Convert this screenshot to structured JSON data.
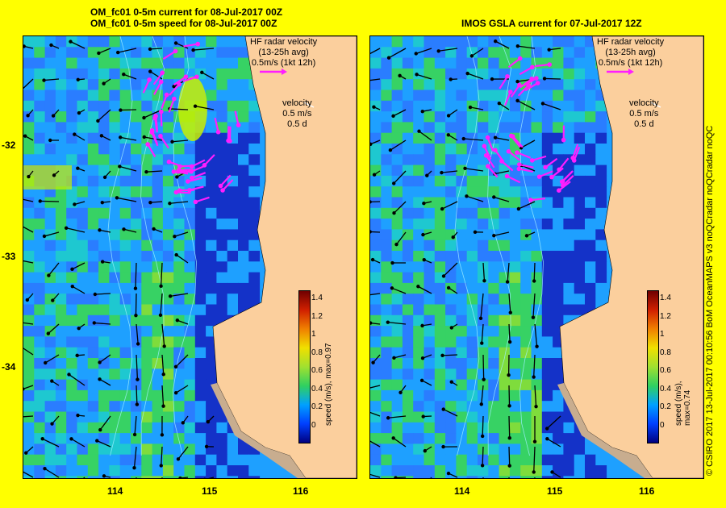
{
  "left_panel": {
    "title_line1": "OM_fc01 0-5m current for 08-Jul-2017 00Z",
    "title_line2": "OM_fc01 0-5m speed for 08-Jul-2017 00Z",
    "radar_legend": [
      "HF radar velocity",
      "(13-25h avg)",
      "0.5m/s (1kt 12h)"
    ],
    "velocity_legend": [
      "velocity",
      "0.5 m/s",
      "0.5 d"
    ],
    "colorbar_label": "speed (m/s), max=0.97"
  },
  "right_panel": {
    "title_line1": "IMOS GSLA current for 07-Jul-2017 12Z",
    "radar_legend": [
      "HF radar velocity",
      "(13-25h avg)",
      "0.5m/s (1kt 12h)"
    ],
    "velocity_legend": [
      "velocity",
      "0.5 m/s",
      "0.5 d"
    ],
    "colorbar_label": "speed (m/s), max=0.74"
  },
  "colorbar_ticks": [
    "1.4",
    "1.2",
    "1",
    "0.8",
    "0.6",
    "0.4",
    "0.2",
    "0"
  ],
  "x_ticks": [
    "114",
    "115",
    "116"
  ],
  "y_ticks": [
    "-32",
    "-33",
    "-34"
  ],
  "credit": "© CSIRO 2017   13-Jul-2017 00:10:56 BoM OceanMAPS v3 noQCradar noQCradar noQC",
  "colors": {
    "land": "#fbcf9d",
    "shelf_land": "#c8ad8f",
    "ocean_low": "#1432c8",
    "ocean_mid": "#1ea0ff",
    "ocean_high": "#37d264",
    "current_core": "#c8f000",
    "radar_arrow": "#ff1eff",
    "background": "#ffff00"
  }
}
